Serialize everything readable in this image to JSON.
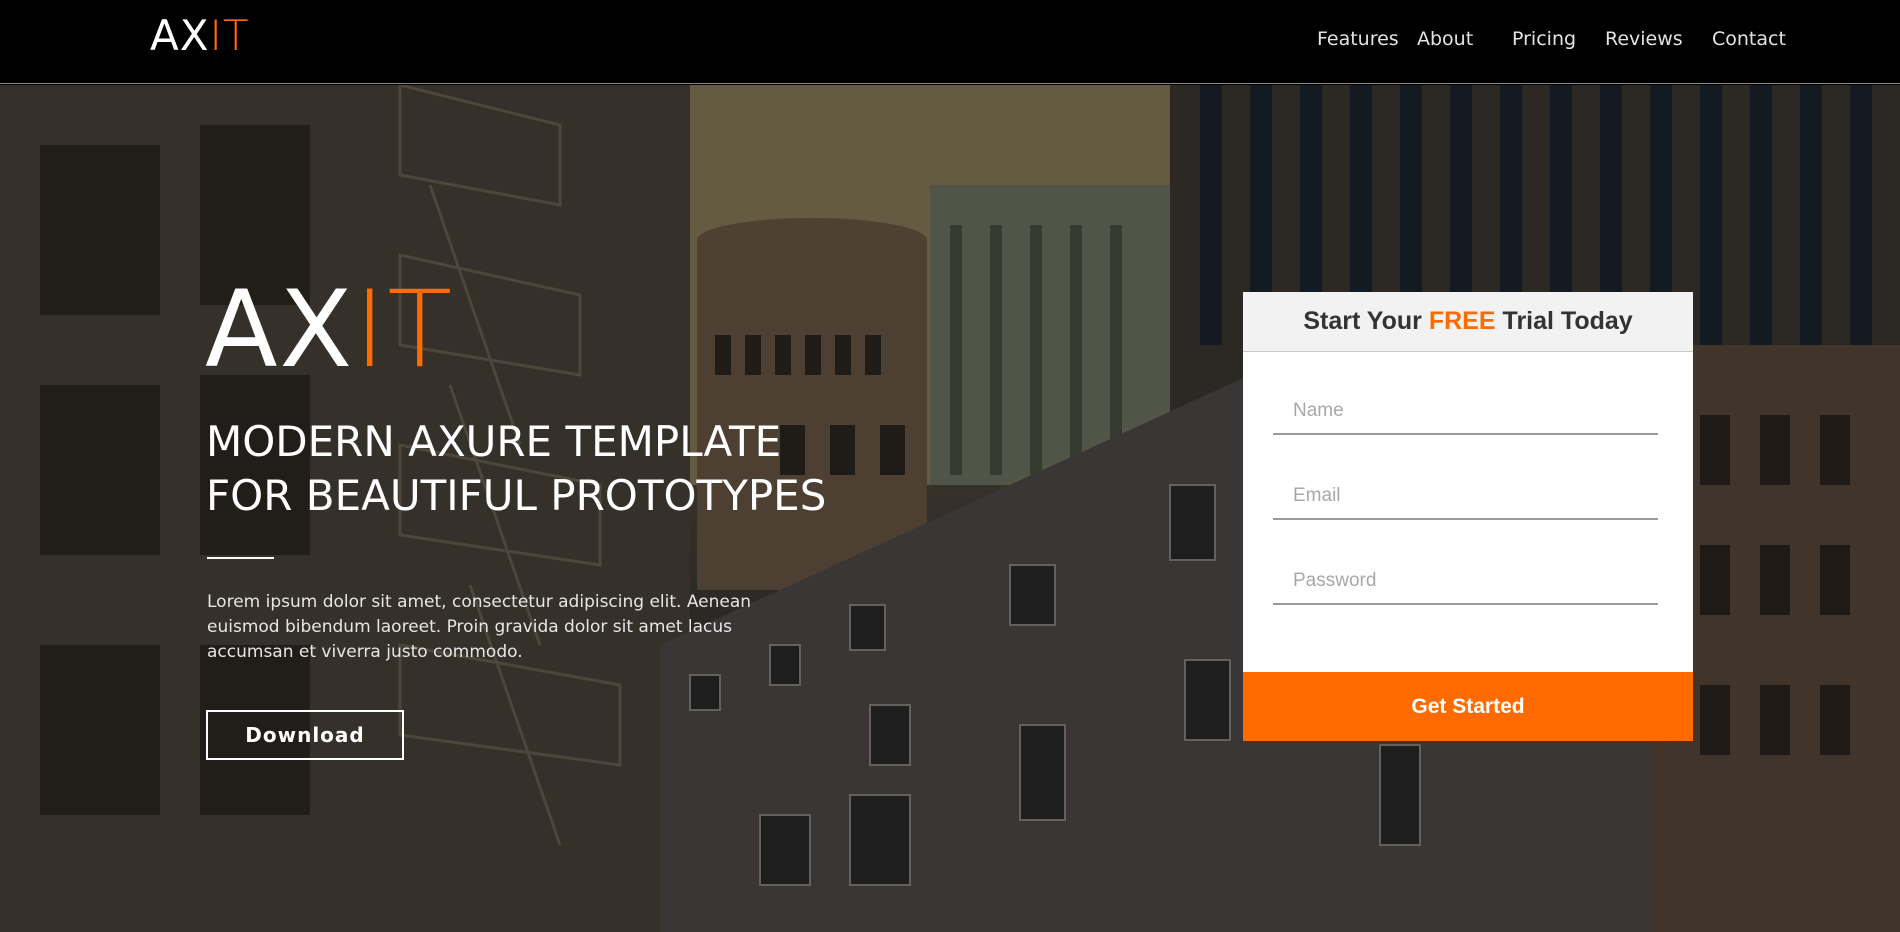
{
  "nav": {
    "logo_main": "AX",
    "logo_accent": "IT",
    "links": [
      "Features",
      "About",
      "Pricing",
      "Reviews",
      "Contact"
    ]
  },
  "hero": {
    "logo_main": "AX",
    "logo_accent": "IT",
    "headline_line1": "MODERN AXURE TEMPLATE",
    "headline_line2": "FOR BEAUTIFUL PROTOTYPES",
    "body": "Lorem ipsum dolor sit amet, consectetur adipiscing elit. Aenean euismod bibendum laoreet. Proin gravida dolor sit amet lacus accumsan et viverra justo commodo.",
    "download_label": "Download"
  },
  "form": {
    "title_before": "Start Your",
    "title_highlight": "FREE",
    "title_after": "Trial Today",
    "name_placeholder": "Name",
    "email_placeholder": "Email",
    "password_placeholder": "Password",
    "submit_label": "Get Started"
  },
  "colors": {
    "accent": "#ff6b00",
    "nav_bg": "#000000",
    "text_light": "#ffffff"
  }
}
